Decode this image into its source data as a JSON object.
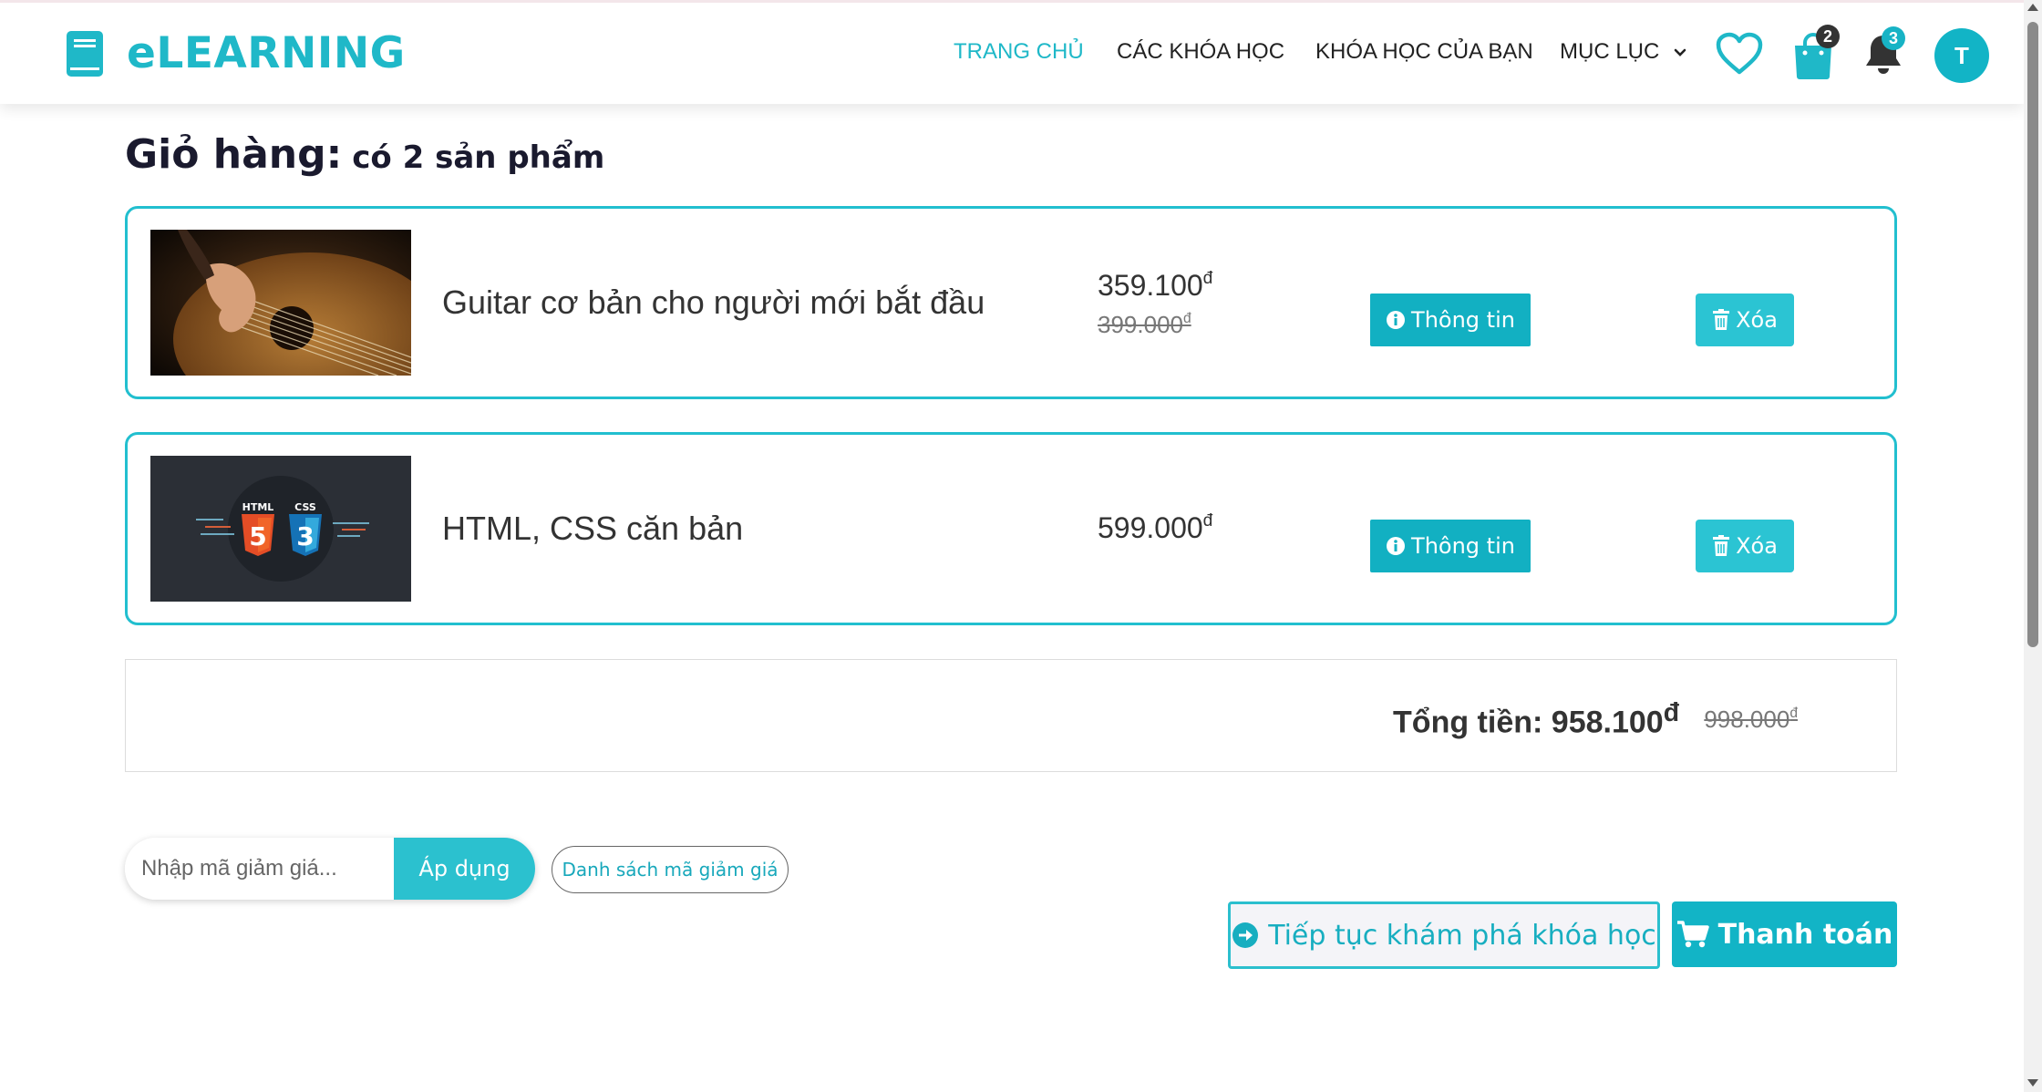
{
  "header": {
    "logo_text": "eLEARNING",
    "nav": [
      {
        "label": "TRANG CHỦ",
        "active": true
      },
      {
        "label": "CÁC KHÓA HỌC",
        "active": false
      },
      {
        "label": "KHÓA HỌC CỦA BẠN",
        "active": false
      },
      {
        "label": "MỤC LỤC",
        "active": false
      }
    ],
    "cart_count": "2",
    "notification_count": "3",
    "avatar_initial": "T"
  },
  "cart": {
    "title": "Giỏ hàng:",
    "subtitle": "có 2 sản phẩm",
    "items": [
      {
        "name": "Guitar cơ bản cho người mới bắt đầu",
        "price": "359.100",
        "old_price": "399.000",
        "currency": "đ",
        "info_label": "Thông tin",
        "delete_label": "Xóa",
        "image": "guitar-thumbnail"
      },
      {
        "name": "HTML, CSS căn bản",
        "price": "599.000",
        "currency": "đ",
        "info_label": "Thông tin",
        "delete_label": "Xóa",
        "image": "html-css-thumbnail"
      }
    ],
    "total_label": "Tổng tiền:",
    "total": "958.100",
    "total_old": "998.000",
    "currency": "đ"
  },
  "coupon": {
    "placeholder": "Nhập mã giảm giá...",
    "apply_label": "Áp dụng",
    "list_label": "Danh sách mã giảm giá"
  },
  "actions": {
    "continue_label": "Tiếp tục khám phá khóa học",
    "checkout_label": "Thanh toán"
  },
  "colors": {
    "accent": "#1fb8c8",
    "button": "#12b0c2",
    "badge_dark": "#333333"
  },
  "html_thumb": {
    "html_text": "HTML",
    "css_text": "CSS",
    "html_digit": "5",
    "css_digit": "3"
  }
}
